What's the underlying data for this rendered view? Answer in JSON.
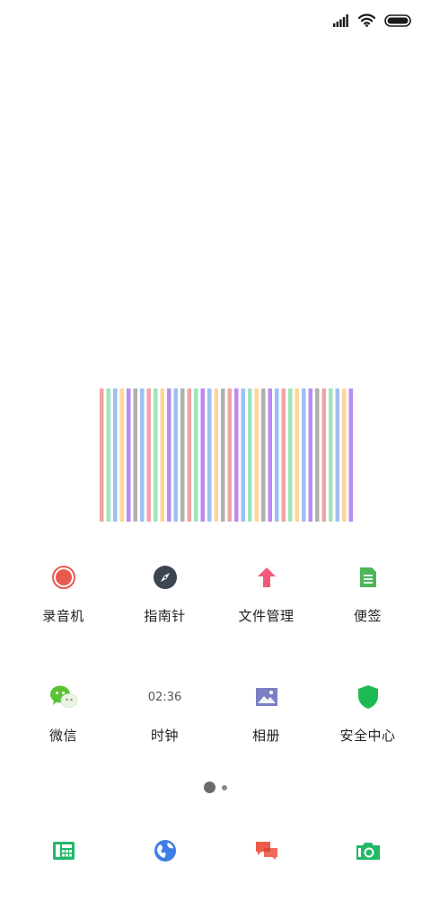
{
  "status_bar": {
    "icons": [
      "signal-icon",
      "wifi-icon",
      "battery-icon"
    ]
  },
  "home_screen": {
    "apps": [
      {
        "label": "录音机",
        "icon": "recorder-icon",
        "color": "#E85A4F"
      },
      {
        "label": "指南针",
        "icon": "compass-icon",
        "color": "#3E4452"
      },
      {
        "label": "文件管理",
        "icon": "file-manager-icon",
        "color": "#F25A79"
      },
      {
        "label": "便签",
        "icon": "notes-icon",
        "color": "#4CB75A"
      },
      {
        "label": "微信",
        "icon": "wechat-icon",
        "color": "#5BC236"
      },
      {
        "label": "时钟",
        "icon": "clock-icon",
        "clock_text": "02:36",
        "color": "#555555"
      },
      {
        "label": "相册",
        "icon": "gallery-icon",
        "color": "#7B7FC4"
      },
      {
        "label": "安全中心",
        "icon": "security-center-icon",
        "color": "#1DBA54"
      }
    ],
    "page_indicator": {
      "pages": 2,
      "current": 1
    }
  },
  "dock": {
    "apps": [
      {
        "icon": "phone-icon",
        "color": "#20B86A"
      },
      {
        "icon": "browser-icon",
        "color": "#3F7FE4"
      },
      {
        "icon": "messages-icon",
        "color": "#EE5A4A"
      },
      {
        "icon": "camera-icon",
        "color": "#22B866"
      }
    ]
  },
  "barcode_widget": {
    "colors": [
      "#F2A3A3",
      "#9FE5B8",
      "#B88CF0",
      "#FFD59A",
      "#9DC0F2",
      "#B0B0B0"
    ]
  }
}
